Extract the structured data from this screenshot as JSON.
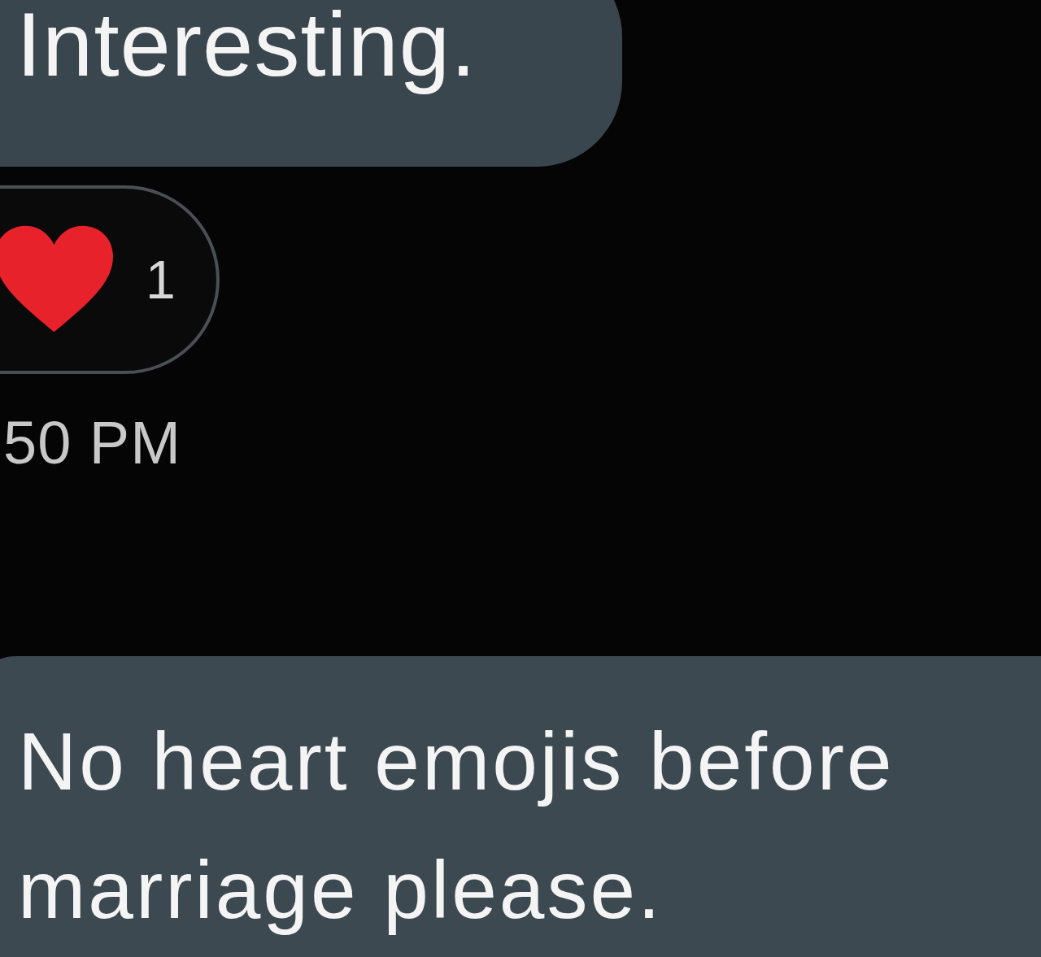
{
  "messages": [
    {
      "text": "Interesting.",
      "reaction": {
        "count": "1"
      },
      "time": "50 PM"
    },
    {
      "text": "No heart emojis before marriage please."
    }
  ]
}
